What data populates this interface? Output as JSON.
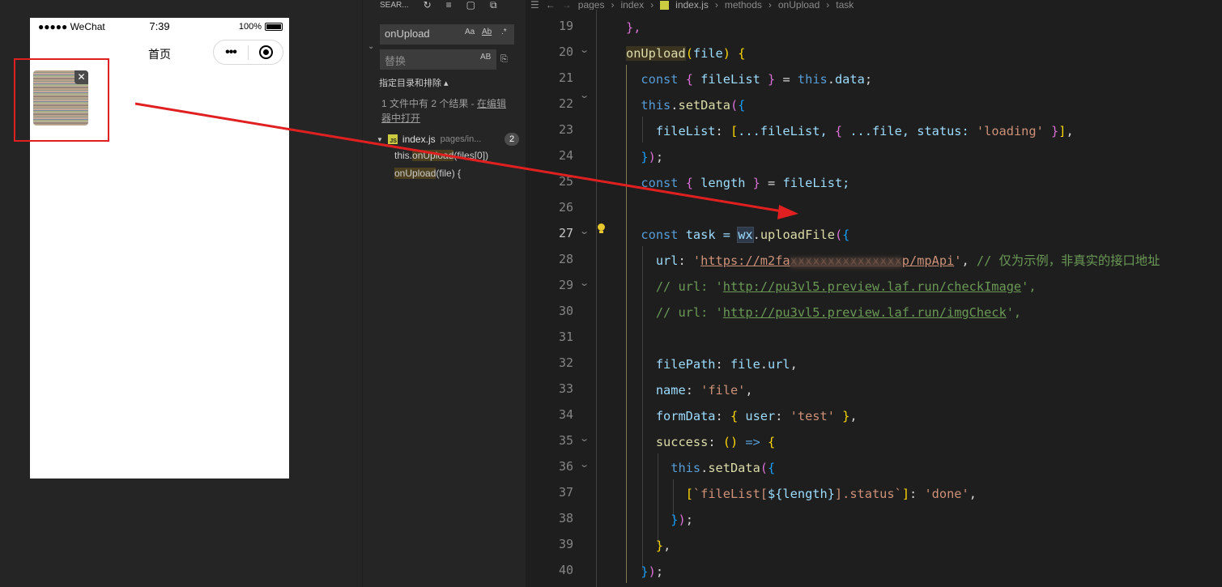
{
  "simulator": {
    "status": {
      "carrier": "●●●●● WeChat",
      "wifi_icon": "wifi-icon",
      "time": "7:39",
      "battery": "100%"
    },
    "nav_title": "首页",
    "capsule": {
      "more": "•••",
      "close_icon": "record-icon"
    },
    "upload_thumb": {
      "delete": "✕"
    }
  },
  "search_panel": {
    "title": "SEAR...",
    "header_icons": [
      "refresh-icon",
      "clear-results-icon",
      "new-search-editor-icon",
      "collapse-all-icon"
    ],
    "query": "onUpload",
    "options": {
      "case": "Aa",
      "word": "Ab",
      "regex": ".*"
    },
    "replace_placeholder": "替换",
    "replace_case": "AB",
    "scope_label": "指定目录和排除 ▴",
    "summary_prefix": "1 文件中有 2 个结果 - ",
    "summary_link": "在编辑器中打开",
    "file": {
      "name": "index.js",
      "path": "pages/in...",
      "count": "2"
    },
    "matches": [
      {
        "pre": "this.",
        "hit": "onUpload",
        "post": "(files[0])"
      },
      {
        "pre": "",
        "hit": "onUpload",
        "post": "(file) {"
      }
    ]
  },
  "editor": {
    "breadcrumb": [
      "pages",
      "index",
      "index.js",
      "methods",
      "onUpload",
      "task"
    ],
    "line_numbers": [
      "19",
      "20",
      "21",
      "22",
      "23",
      "24",
      "25",
      "26",
      "27",
      "28",
      "29",
      "30",
      "31",
      "32",
      "33",
      "34",
      "35",
      "36",
      "37",
      "38",
      "39",
      "40"
    ],
    "active_line": "27",
    "code": {
      "l19": "},",
      "l20_name": "onUpload",
      "l20_param": "file",
      "l21_a": "const",
      "l21_b": "fileList",
      "l21_c": "this",
      "l21_d": "data",
      "l22_a": "this",
      "l22_b": "setData",
      "l23_a": "fileList",
      "l23_b": "...fileList,",
      "l23_c": "...file, status:",
      "l23_d": "'loading'",
      "l25_a": "const",
      "l25_b": "length",
      "l25_c": "fileList;",
      "l27_a": "const",
      "l27_b": "task =",
      "l27_c": "wx",
      "l27_d": "uploadFile",
      "l28_key": "url",
      "l28_url_start": "https://m2fa",
      "l28_url_blur": "xxxxxxxxxxxxxxx",
      "l28_url_end": "p/mpApi",
      "l28_comment": "// 仅为示例，非真实的接口地址",
      "l29_prefix": "// url: '",
      "l29_url": "http://pu3vl5.preview.laf.run/checkImage",
      "l29_suffix": "',",
      "l30_prefix": "// url: '",
      "l30_url": "http://pu3vl5.preview.laf.run/imgCheck",
      "l30_suffix": "',",
      "l32_a": "filePath",
      "l32_b": "file",
      "l32_c": "url",
      "l33_a": "name",
      "l33_b": "'file'",
      "l34_a": "formData",
      "l34_b": "user",
      "l34_c": "'test'",
      "l35_a": "success",
      "l36_a": "this",
      "l36_b": "setData",
      "l37_a": "fileList[",
      "l37_b": "${length}",
      "l37_c": "].status",
      "l37_d": "'done'"
    }
  },
  "annotation": {
    "color": "#e02020"
  }
}
